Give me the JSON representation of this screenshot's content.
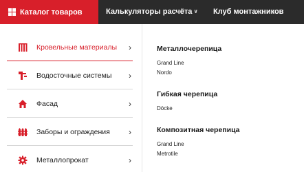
{
  "header": {
    "catalog_label": "Каталог товаров",
    "nav": [
      {
        "label": "Калькуляторы расчёта"
      },
      {
        "label": "Клуб монтажников"
      }
    ]
  },
  "sidebar": {
    "items": [
      {
        "label": "Кровельные материалы",
        "icon": "roofing-icon",
        "active": true
      },
      {
        "label": "Водосточные системы",
        "icon": "gutter-icon"
      },
      {
        "label": "Фасад",
        "icon": "house-icon"
      },
      {
        "label": "Заборы и ограждения",
        "icon": "fence-icon"
      },
      {
        "label": "Металлопрокат",
        "icon": "gear-icon"
      }
    ]
  },
  "content": {
    "groups": [
      {
        "title": "Металлочерепица",
        "brands": [
          "Grand Line",
          "Nordo"
        ]
      },
      {
        "title": "Гибкая черепица",
        "brands": [
          "Döcke"
        ]
      },
      {
        "title": "Композитная черепица",
        "brands": [
          "Grand Line",
          "Metrotile"
        ]
      }
    ]
  },
  "colors": {
    "accent": "#d81f2a",
    "topbar": "#2b2b2b"
  }
}
